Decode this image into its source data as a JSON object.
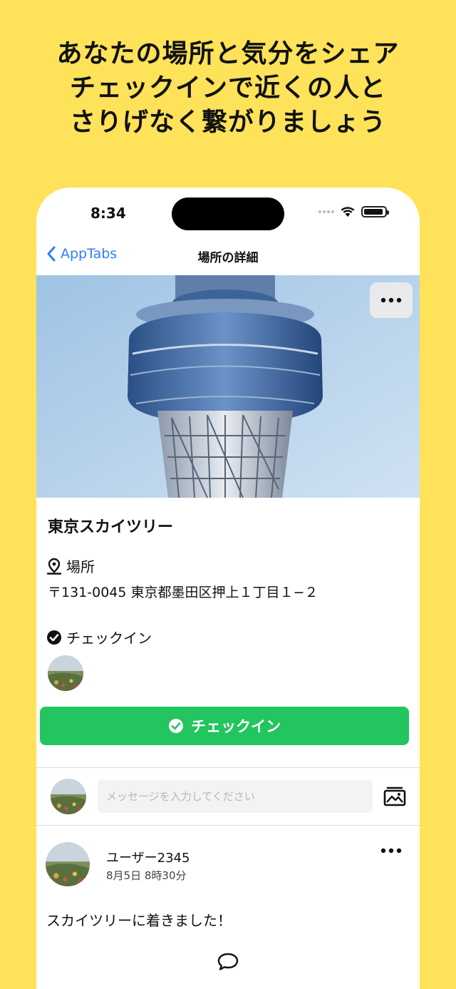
{
  "promo": {
    "line1": "あなたの場所と気分をシェア",
    "line2": "チェックインで近くの人と",
    "line3": "さりげなく繋がりましょう"
  },
  "status_bar": {
    "time": "8:34"
  },
  "nav": {
    "back_label": "AppTabs",
    "title": "場所の詳細"
  },
  "place": {
    "name": "東京スカイツリー",
    "location_label": "場所",
    "address": "〒131-0045 東京都墨田区押上１丁目１−２",
    "checkin_label": "チェックイン"
  },
  "checkin_button": {
    "label": "チェックイン"
  },
  "composer": {
    "placeholder": "メッセージを入力してください"
  },
  "post": {
    "user": "ユーザー2345",
    "time": "8月5日 8時30分",
    "body": "スカイツリーに着きました！"
  },
  "colors": {
    "background": "#fde25a",
    "accent": "#22c55e",
    "link": "#2d7ff9"
  },
  "icons": {
    "back": "chevron-left-icon",
    "more": "ellipsis-icon",
    "location": "map-pin-icon",
    "checkin": "check-circle-icon",
    "photo": "photo-icon",
    "comment": "speech-bubble-icon"
  }
}
